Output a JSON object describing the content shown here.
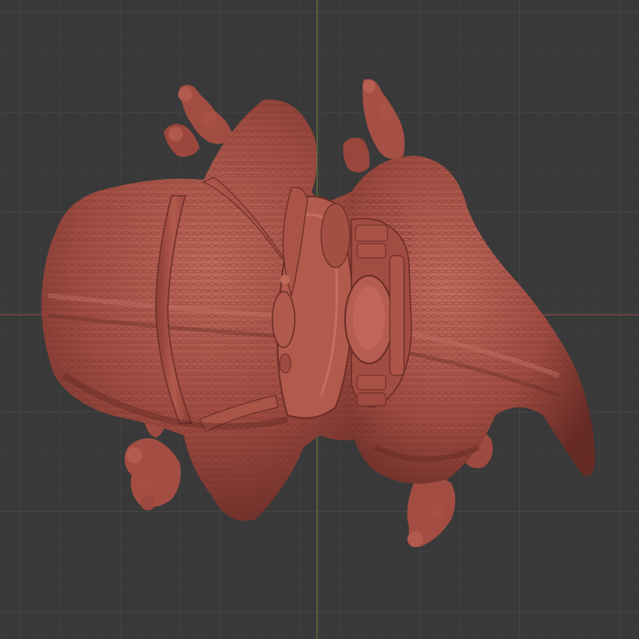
{
  "viewport": {
    "background": "#393939",
    "grid_minor_color": "#424242",
    "grid_major_color": "#4a4a4a",
    "axis_x_color": "#7a4646",
    "axis_y_color": "#5e6b3a",
    "view_orientation": "top"
  },
  "model": {
    "material": "clay",
    "base_color": "#9e4a40",
    "highlight_color": "#c4685b",
    "shadow_color": "#5e2722",
    "icon": "sculpt-mesh-icon"
  }
}
